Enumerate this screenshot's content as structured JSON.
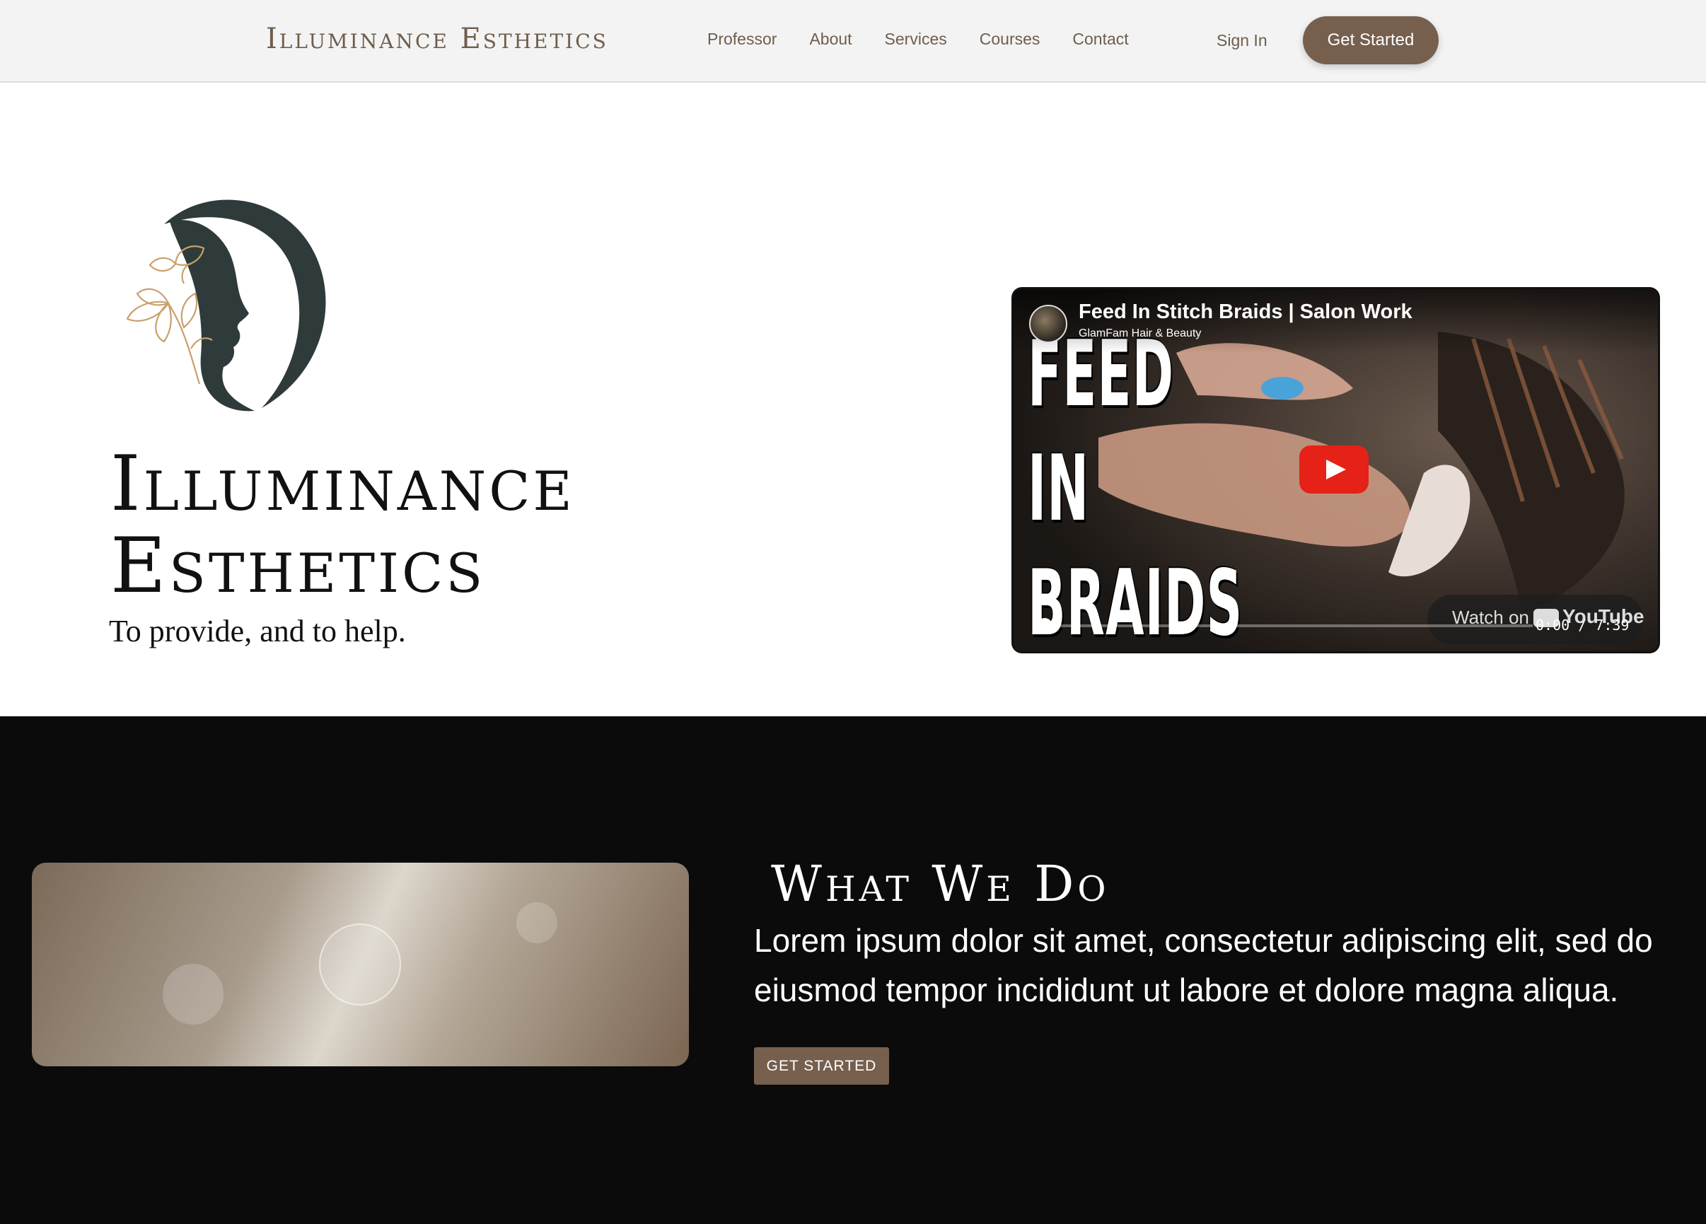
{
  "nav": {
    "brand": "Illuminance Esthetics",
    "links": [
      "Professor",
      "About",
      "Services",
      "Courses",
      "Contact"
    ],
    "sign_in": "Sign In",
    "cta": "Get Started"
  },
  "hero": {
    "title_line1": "Illuminance",
    "title_line2": "Esthetics",
    "tagline": "To provide, and to help.",
    "logo_icon": "woman-profile-flower-logo"
  },
  "video": {
    "title": "Feed In Stitch Braids | Salon Work",
    "channel": "GlamFam Hair & Beauty",
    "overlay_words": [
      "FEED",
      "IN",
      "BRAIDS"
    ],
    "watch_on": "Watch on",
    "platform": "YouTube",
    "time": "0:00 / 7:39",
    "progress": 0
  },
  "what_we_do": {
    "title": "What We Do",
    "body": "Lorem ipsum dolor sit amet, consectetur adipiscing elit, sed do eiusmod tempor incididunt ut labore et dolore magna aliqua.",
    "cta": "GET STARTED"
  },
  "colors": {
    "brand_brown": "#765f4d",
    "nav_bg": "#f3f3f3",
    "dark_bg": "#0b0b0b",
    "logo_teal": "#2e3b3a",
    "flower_gold": "#c9a06a",
    "youtube_red": "#e62117"
  }
}
